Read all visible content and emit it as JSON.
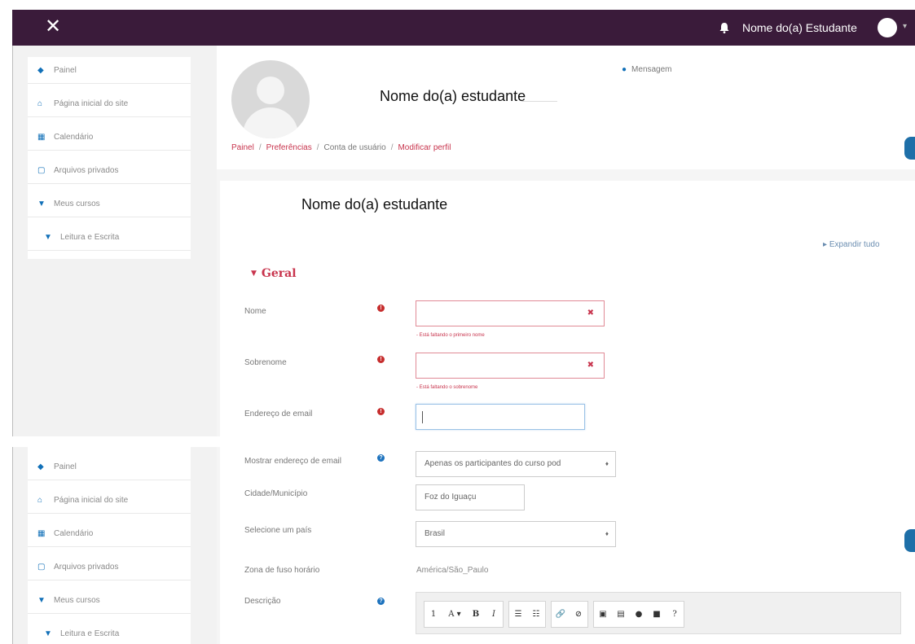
{
  "navbar": {
    "close_icon": "close-icon",
    "bell_icon": "bell-icon",
    "user_name": "Nome do(a) Estudante",
    "caret_icon": "chevron-down-icon"
  },
  "sidebar_top": {
    "items": [
      {
        "label": "Painel",
        "icon": "dashboard-icon"
      },
      {
        "label": "Página inicial do site",
        "icon": "home-icon"
      },
      {
        "label": "Calendário",
        "icon": "calendar-icon"
      },
      {
        "label": "Arquivos privados",
        "icon": "file-icon"
      },
      {
        "label": "Meus cursos",
        "icon": "graduation-cap-icon"
      },
      {
        "label": "Leitura e Escrita",
        "icon": "graduation-cap-icon"
      }
    ]
  },
  "sidebar_bottom": {
    "items": [
      {
        "label": "Painel",
        "icon": "dashboard-icon"
      },
      {
        "label": "Página inicial do site",
        "icon": "home-icon"
      },
      {
        "label": "Calendário",
        "icon": "calendar-icon"
      },
      {
        "label": "Arquivos privados",
        "icon": "file-icon"
      },
      {
        "label": "Meus cursos",
        "icon": "graduation-cap-icon"
      },
      {
        "label": "Leitura e Escrita",
        "icon": "graduation-cap-icon"
      }
    ]
  },
  "header": {
    "name": "Nome do(a) estudante",
    "message_link": "Mensagem",
    "breadcrumb": [
      {
        "label": "Painel",
        "link": true
      },
      {
        "label": "Preferências",
        "link": true
      },
      {
        "label": "Conta de usuário",
        "link": false
      },
      {
        "label": "Modificar perfil",
        "link": true
      }
    ],
    "separator": "/"
  },
  "main": {
    "heading": "Nome do(a) estudante",
    "expand_all": "Expandir tudo",
    "section_title": "Geral"
  },
  "form": {
    "first_name": {
      "label": "Nome",
      "value": "",
      "error": "Está faltando o primeiro nome"
    },
    "last_name": {
      "label": "Sobrenome",
      "value": "",
      "error": "Está faltando o sobrenome"
    },
    "email": {
      "label": "Endereço de email",
      "value": ""
    },
    "email_display": {
      "label": "Mostrar endereço de email",
      "value": "Apenas os participantes do curso pod"
    },
    "city": {
      "label": "Cidade/Município",
      "value": "Foz do Iguaçu"
    },
    "country": {
      "label": "Selecione um país",
      "value": "Brasil"
    },
    "timezone": {
      "label": "Zona de fuso horário",
      "value": "América/São_Paulo"
    },
    "description": {
      "label": "Descrição"
    }
  },
  "editor_toolbar": {
    "groups": [
      [
        {
          "label": "1",
          "icon": "toggle-toolbar-icon"
        },
        {
          "label": "A ▾",
          "icon": "font-style-icon"
        },
        {
          "label": "B",
          "icon": "bold-icon"
        },
        {
          "label": "I",
          "icon": "italic-icon"
        }
      ],
      [
        {
          "label": "☰",
          "icon": "unordered-list-icon"
        },
        {
          "label": "☷",
          "icon": "ordered-list-icon"
        }
      ],
      [
        {
          "label": "🔗",
          "icon": "link-icon"
        },
        {
          "label": "⊘",
          "icon": "unlink-icon"
        }
      ],
      [
        {
          "label": "▣",
          "icon": "image-icon"
        },
        {
          "label": "▤",
          "icon": "media-icon"
        },
        {
          "label": "●",
          "icon": "record-audio-icon"
        },
        {
          "label": "■",
          "icon": "record-video-icon"
        },
        {
          "label": "?",
          "icon": "manage-files-icon"
        }
      ]
    ]
  }
}
